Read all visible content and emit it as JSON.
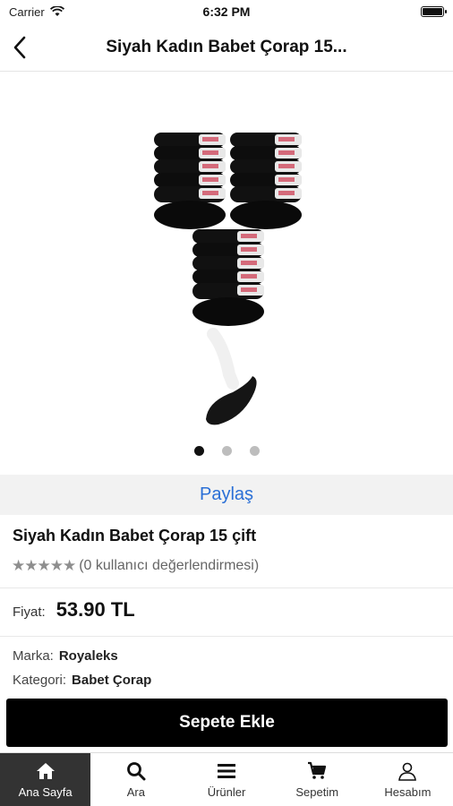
{
  "status_bar": {
    "carrier": "Carrier",
    "time": "6:32 PM"
  },
  "nav": {
    "title": "Siyah Kadın Babet Çorap 15..."
  },
  "gallery": {
    "image_count": 3,
    "active_index": 0
  },
  "share": {
    "label": "Paylaş"
  },
  "product": {
    "name": "Siyah Kadın Babet Çorap 15 çift",
    "rating_stars": 0,
    "rating_text": "(0 kullanıcı değerlendirmesi)",
    "price_label": "Fiyat:",
    "price_value": "53.90 TL",
    "brand_label": "Marka:",
    "brand_value": "Royaleks",
    "category_label": "Kategori:",
    "category_value": "Babet Çorap"
  },
  "cta": {
    "add_to_cart": "Sepete Ekle"
  },
  "tabs": [
    {
      "label": "Ana Sayfa",
      "icon": "home-icon",
      "active": true
    },
    {
      "label": "Ara",
      "icon": "search-icon",
      "active": false
    },
    {
      "label": "Ürünler",
      "icon": "menu-icon",
      "active": false
    },
    {
      "label": "Sepetim",
      "icon": "cart-icon",
      "active": false
    },
    {
      "label": "Hesabım",
      "icon": "user-icon",
      "active": false
    }
  ],
  "colors": {
    "accent_link": "#2a6fd6",
    "cta_bg": "#000000",
    "tab_active_bg": "#333333"
  }
}
